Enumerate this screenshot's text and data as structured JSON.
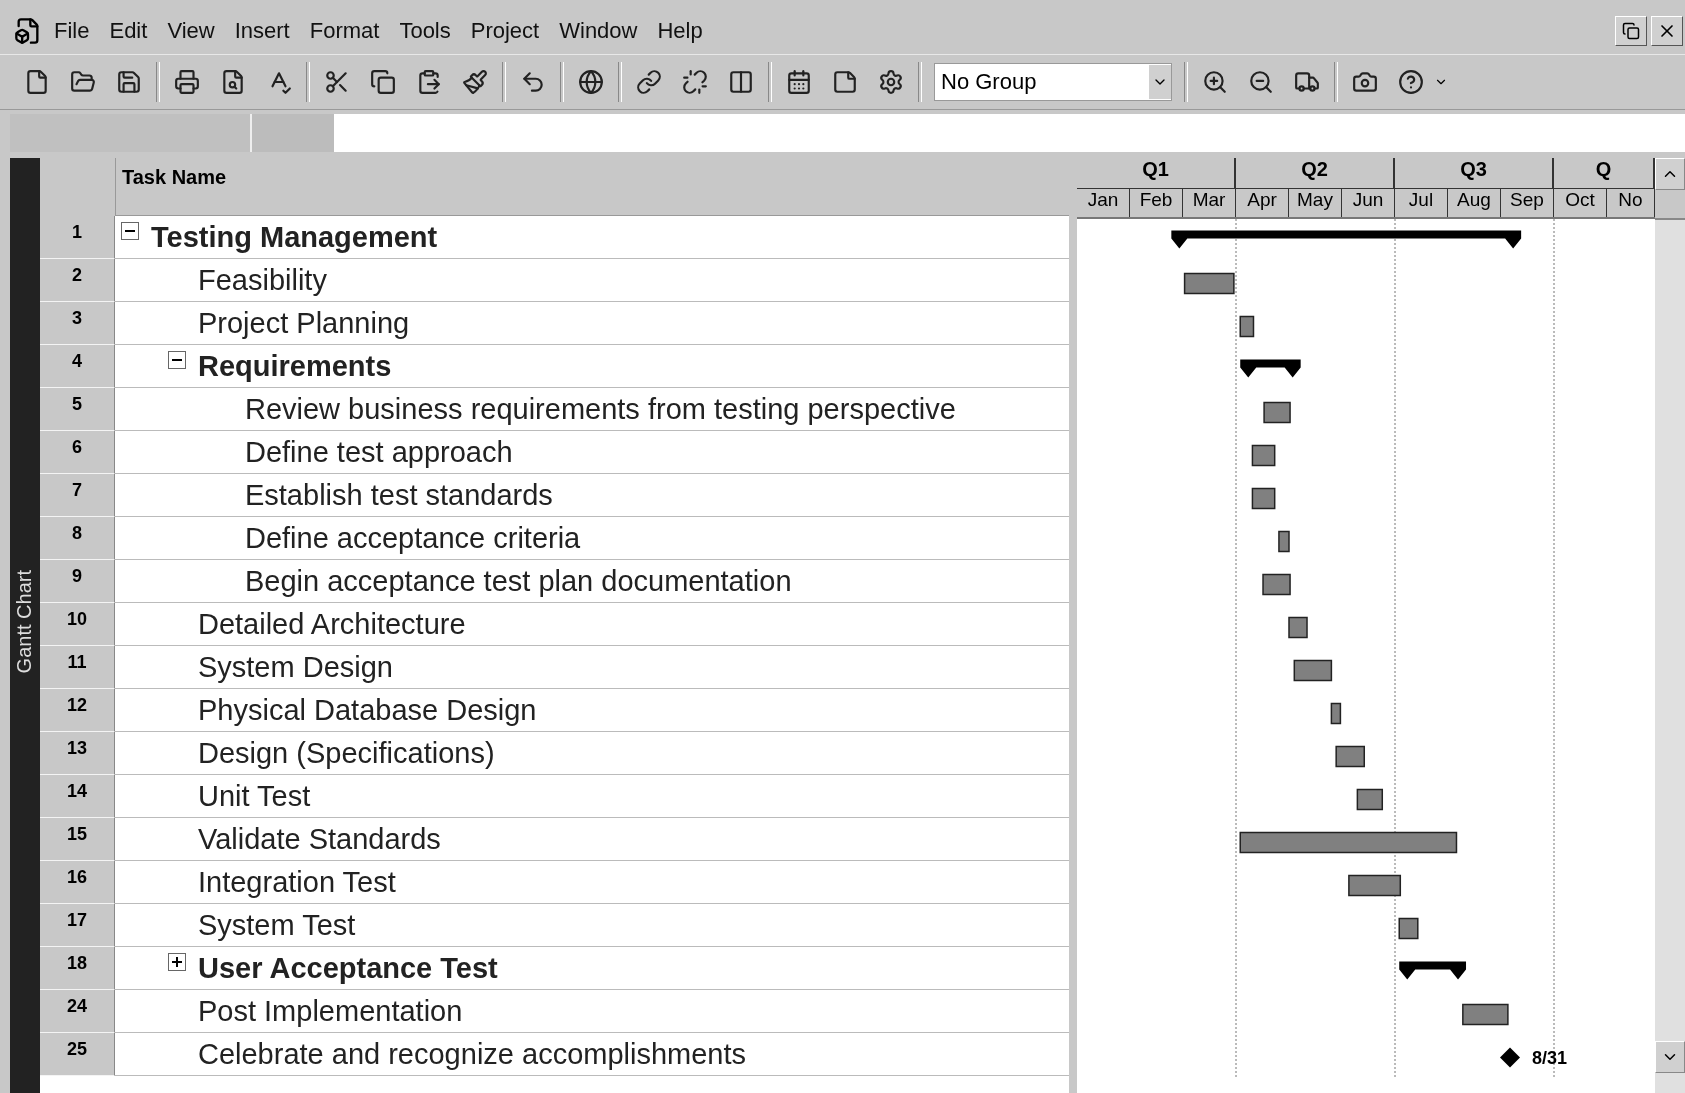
{
  "menu_bar": {
    "items": [
      "File",
      "Edit",
      "View",
      "Insert",
      "Format",
      "Tools",
      "Project",
      "Window",
      "Help"
    ]
  },
  "toolbar": {
    "group_dropdown": {
      "value": "No Group"
    }
  },
  "view_bar": {
    "label": "Gantt Chart"
  },
  "table": {
    "columns": [
      "Task Name"
    ],
    "tasks": [
      {
        "id": "1",
        "name": "Testing Management",
        "kind": "summary",
        "expanded": true,
        "children": [
          {
            "id": "2",
            "name": "Feasibility",
            "kind": "task"
          },
          {
            "id": "3",
            "name": "Project Planning",
            "kind": "task"
          },
          {
            "id": "4",
            "name": "Requirements",
            "kind": "summary",
            "expanded": true,
            "children": [
              {
                "id": "5",
                "name": "Review business requirements from testing perspective",
                "kind": "task"
              },
              {
                "id": "6",
                "name": "Define test approach",
                "kind": "task"
              },
              {
                "id": "7",
                "name": "Establish test standards",
                "kind": "task"
              },
              {
                "id": "8",
                "name": "Define acceptance criteria",
                "kind": "task"
              },
              {
                "id": "9",
                "name": "Begin acceptance test plan documentation",
                "kind": "task"
              }
            ]
          },
          {
            "id": "10",
            "name": "Detailed Architecture",
            "kind": "task"
          },
          {
            "id": "11",
            "name": "System Design",
            "kind": "task"
          },
          {
            "id": "12",
            "name": "Physical Database Design",
            "kind": "task"
          },
          {
            "id": "13",
            "name": "Design (Specifications)",
            "kind": "task"
          },
          {
            "id": "14",
            "name": "Unit Test",
            "kind": "task"
          },
          {
            "id": "15",
            "name": "Validate Standards",
            "kind": "task"
          },
          {
            "id": "16",
            "name": "Integration Test",
            "kind": "task"
          },
          {
            "id": "17",
            "name": "System Test",
            "kind": "task"
          },
          {
            "id": "18",
            "name": "User Acceptance Test",
            "kind": "summary",
            "expanded": false
          },
          {
            "id": "24",
            "name": "Post Implementation",
            "kind": "task"
          },
          {
            "id": "25",
            "name": "Celebrate and recognize accomplishments",
            "kind": "milestone",
            "bar_label": "8/31"
          }
        ]
      }
    ]
  },
  "gantt": {
    "quarters": [
      "Q1",
      "Q2",
      "Q3",
      "Q"
    ],
    "months": [
      "Jan",
      "Feb",
      "Mar",
      "Apr",
      "May",
      "Jun",
      "Jul",
      "Aug",
      "Sep",
      "Oct",
      "No"
    ]
  }
}
